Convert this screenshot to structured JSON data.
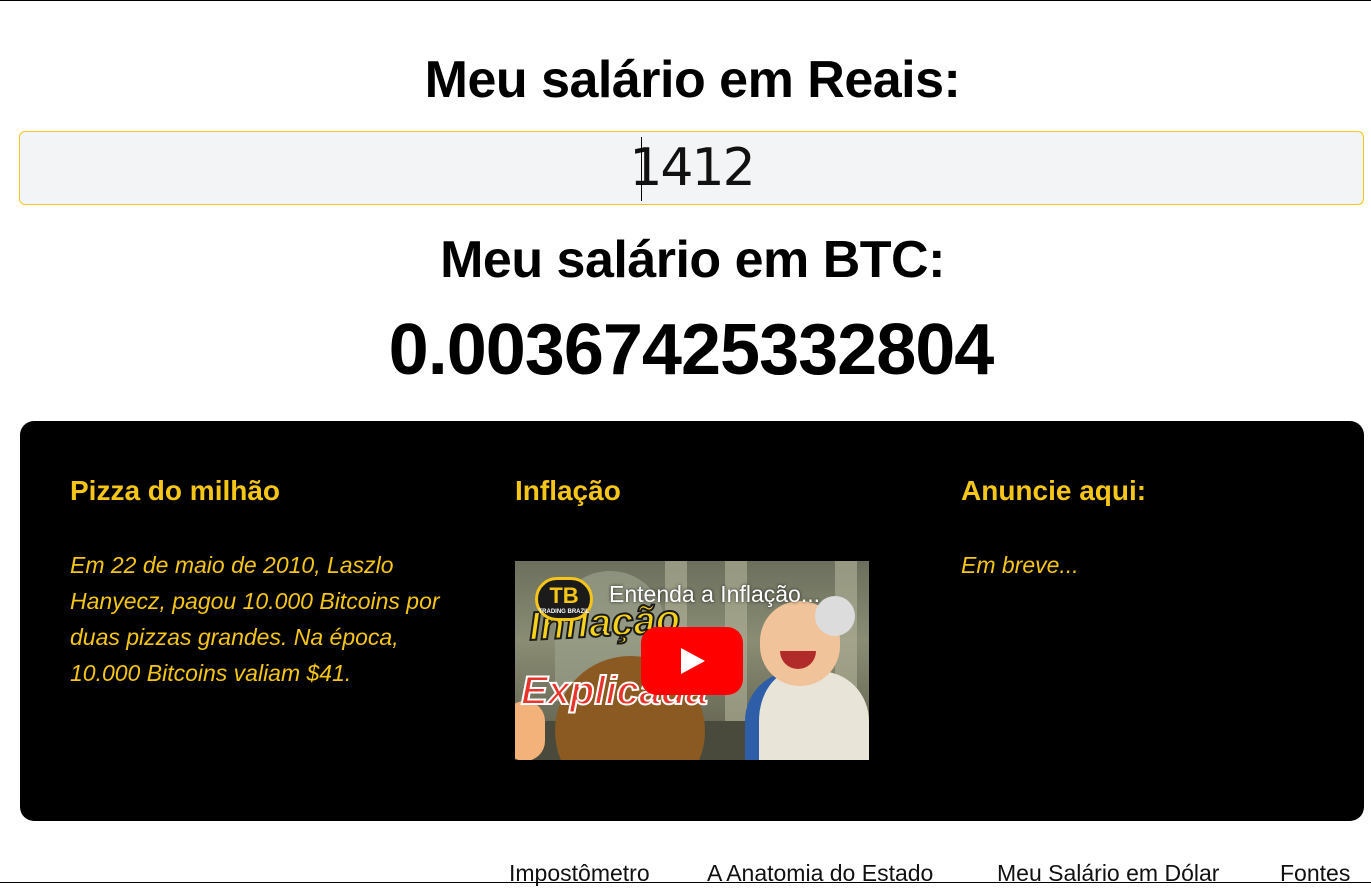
{
  "converter": {
    "heading_reais": "Meu salário em Reais:",
    "salary_input_value": "1412",
    "heading_btc": "Meu salário em BTC:",
    "btc_value": "0.00367425332804"
  },
  "info_panel": {
    "pizza": {
      "title": "Pizza do milhão",
      "text": "Em 22 de maio de 2010, Laszlo Hanyecz, pagou 10.000 Bitcoins por duas pizzas grandes. Na época, 10.000 Bitcoins valiam $41."
    },
    "inflacao": {
      "title": "Inflação",
      "video": {
        "title": "Entenda a Inflação...",
        "thumbnail_word_1": "Inflação",
        "thumbnail_word_2": "Explicada",
        "logo_letters": "TB",
        "logo_sub": "TRADING BRAZIL"
      }
    },
    "anuncie": {
      "title": "Anuncie aqui:",
      "text": "Em breve..."
    }
  },
  "footer_nav": {
    "links": [
      "Impostômetro",
      "A Anatomia do Estado",
      "Meu Salário em Dólar",
      "Fontes"
    ]
  },
  "colors": {
    "accent": "#f5c518",
    "panel_bg": "#000000",
    "input_bg": "#f3f4f6",
    "play_button": "#ff0000"
  },
  "icons": {
    "play": "youtube-play-icon"
  }
}
